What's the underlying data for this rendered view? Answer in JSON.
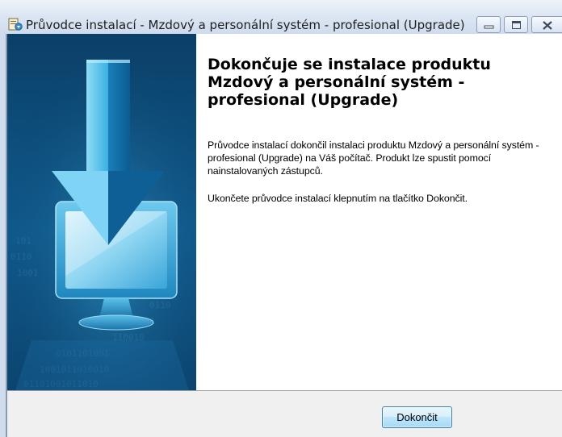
{
  "window": {
    "title": "Průvodce instalací - Mzdový a personální systém - profesional (Upgrade)",
    "icons": {
      "app": "installer-icon",
      "minimize": "minimize-icon",
      "maximize": "maximize-icon",
      "close": "close-icon"
    }
  },
  "banner": {
    "illustration": "download-arrow-monitor"
  },
  "content": {
    "heading": "Dokončuje se instalace produktu Mzdový a personální systém - profesional (Upgrade)",
    "paragraph1": "Průvodce instalací dokončil instalaci produktu Mzdový a personální systém - profesional (Upgrade) na Váš počítač. Produkt lze spustit pomocí nainstalovaných zástupců.",
    "paragraph2": "Ukončete průvodce instalací klepnutím na tlačítko Dokončit."
  },
  "buttons": {
    "finish": "Dokončit"
  },
  "colors": {
    "banner_dark": "#0f4f7e",
    "banner_light": "#7fd0f0",
    "titlebar": "#dde6f3",
    "button_border": "#3c7fb1"
  }
}
